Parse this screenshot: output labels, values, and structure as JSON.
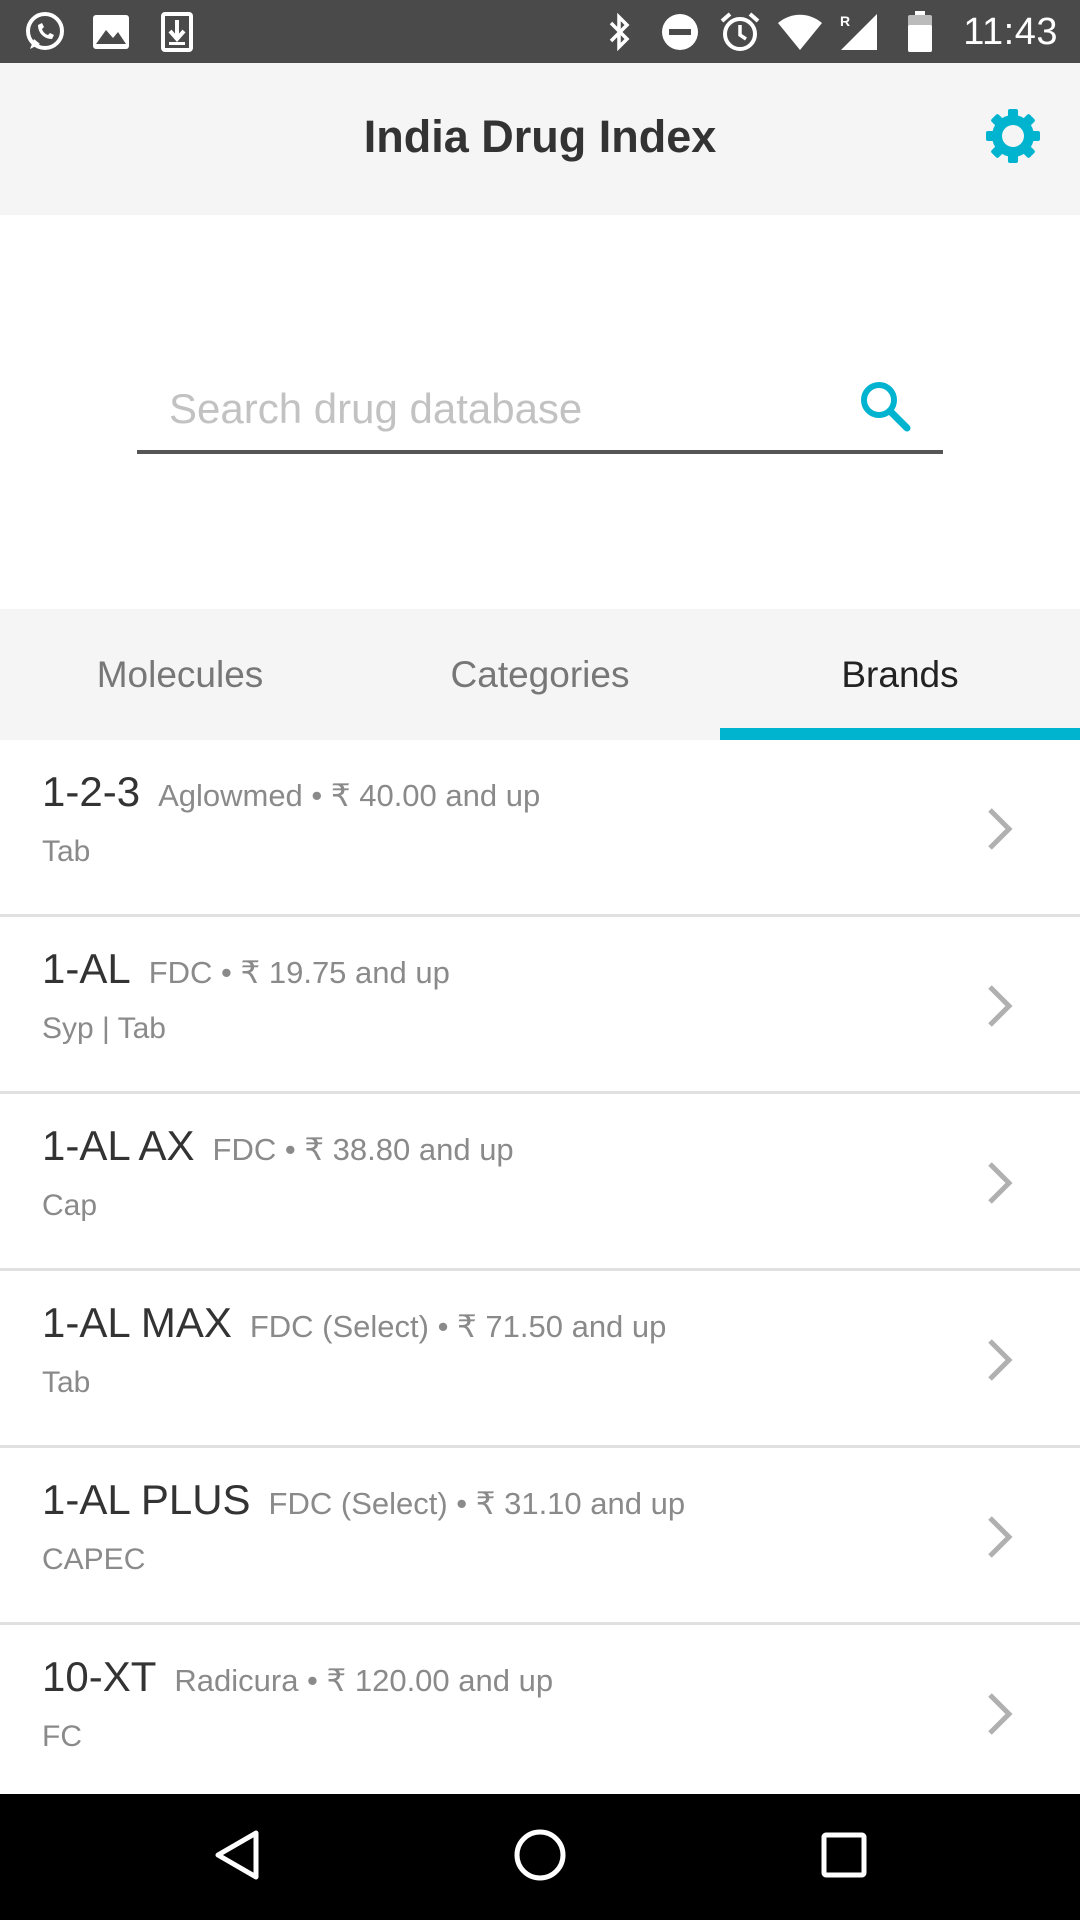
{
  "status_bar": {
    "time": "11:43",
    "left_icons": [
      "whatsapp-icon",
      "image-icon",
      "download-icon"
    ],
    "right_icons": [
      "bluetooth-icon",
      "do-not-disturb-icon",
      "alarm-icon",
      "wifi-icon",
      "signal-roaming-icon",
      "battery-icon"
    ]
  },
  "app_bar": {
    "title": "India Drug Index",
    "settings_icon": "gear-icon"
  },
  "search": {
    "placeholder": "Search drug database",
    "value": "",
    "icon": "search-icon"
  },
  "tabs": [
    {
      "label": "Molecules",
      "active": false
    },
    {
      "label": "Categories",
      "active": false
    },
    {
      "label": "Brands",
      "active": true
    }
  ],
  "brands": [
    {
      "name": "1-2-3",
      "meta": "Aglowmed • ₹ 40.00 and up",
      "form": "Tab"
    },
    {
      "name": "1-AL",
      "meta": "FDC • ₹ 19.75 and up",
      "form": "Syp | Tab"
    },
    {
      "name": "1-AL AX",
      "meta": "FDC • ₹ 38.80 and up",
      "form": "Cap"
    },
    {
      "name": "1-AL MAX",
      "meta": "FDC (Select) • ₹ 71.50 and up",
      "form": "Tab"
    },
    {
      "name": "1-AL PLUS",
      "meta": "FDC (Select) • ₹ 31.10 and up",
      "form": "CAPEC"
    },
    {
      "name": "10-XT",
      "meta": "Radicura • ₹ 120.00 and up",
      "form": "FC"
    }
  ],
  "colors": {
    "accent": "#00b4d0",
    "status_bar": "#4a4a4a",
    "app_bar": "#f5f5f5",
    "nav_bar": "#000000"
  },
  "nav_bar": {
    "icons": [
      "back-icon",
      "home-icon",
      "recents-icon"
    ]
  }
}
